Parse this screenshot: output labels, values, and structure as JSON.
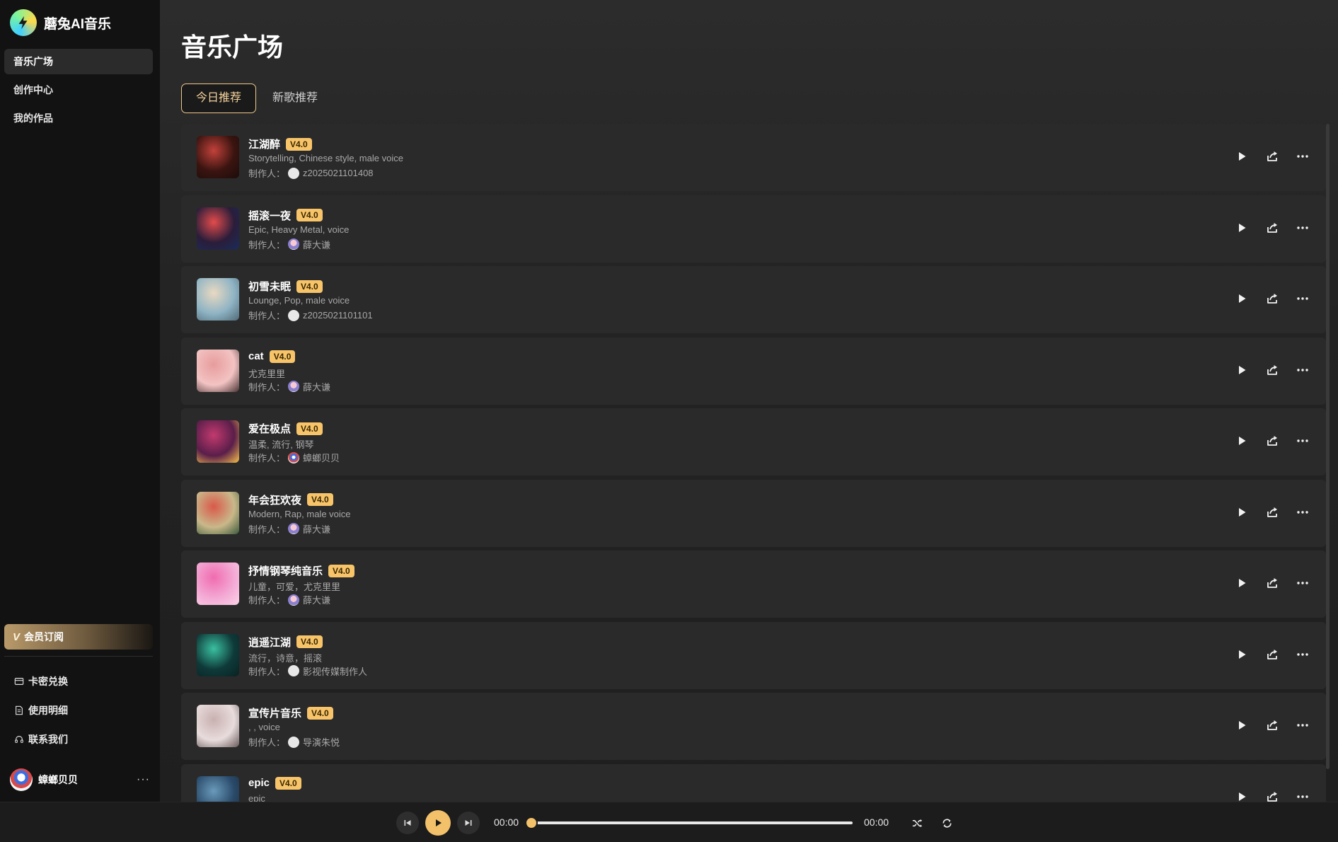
{
  "brand": {
    "name": "蘑兔AI音乐",
    "logo_icon": "lightning-bolt-icon"
  },
  "nav": [
    {
      "label": "音乐广场",
      "active": true
    },
    {
      "label": "创作中心",
      "active": false
    },
    {
      "label": "我的作品",
      "active": false
    }
  ],
  "vip": {
    "label": "会员订阅",
    "icon": "v-badge-icon"
  },
  "side_links": [
    {
      "label": "卡密兑换",
      "icon": "card-icon"
    },
    {
      "label": "使用明细",
      "icon": "document-icon"
    },
    {
      "label": "联系我们",
      "icon": "headset-icon"
    }
  ],
  "user": {
    "name": "蟑螂贝贝",
    "more": "···"
  },
  "page": {
    "title": "音乐广场"
  },
  "tabs": [
    {
      "label": "今日推荐",
      "active": true
    },
    {
      "label": "新歌推荐",
      "active": false
    }
  ],
  "maker_prefix": "制作人：",
  "songs": [
    {
      "name": "江湖醉",
      "version": "V4.0",
      "tags": "Storytelling, Chinese style, male voice",
      "maker": "z2025021101408",
      "cover_colors": [
        "#3a1410",
        "#c2413a",
        "#1b0d0b"
      ],
      "maker_avatar": "plain"
    },
    {
      "name": "摇滚一夜",
      "version": "V4.0",
      "tags": "Epic, Heavy Metal, voice",
      "maker": "薛大谦",
      "cover_colors": [
        "#2a1d3a",
        "#e34b4b",
        "#1a2d5a"
      ],
      "maker_avatar": "pink"
    },
    {
      "name": "初雪未眠",
      "version": "V4.0",
      "tags": "Lounge, Pop, male voice",
      "maker": "z2025021101101",
      "cover_colors": [
        "#8fb4c4",
        "#e9d9c2",
        "#4f6a78"
      ],
      "maker_avatar": "plain"
    },
    {
      "name": "cat",
      "version": "V4.0",
      "tags": "尤克里里",
      "maker": "薛大谦",
      "cover_colors": [
        "#f3c3c3",
        "#e79c9c",
        "#4a3434"
      ],
      "maker_avatar": "pink"
    },
    {
      "name": "爱在极点",
      "version": "V4.0",
      "tags": "温柔, 流行, 钢琴",
      "maker": "蟑螂贝贝",
      "cover_colors": [
        "#5a1e4a",
        "#c23a6e",
        "#f6c04a"
      ],
      "maker_avatar": "bug"
    },
    {
      "name": "年会狂欢夜",
      "version": "V4.0",
      "tags": "Modern, Rap, male voice",
      "maker": "薛大谦",
      "cover_colors": [
        "#c9b88a",
        "#d9594a",
        "#3a5a3a"
      ],
      "maker_avatar": "pink"
    },
    {
      "name": "抒情钢琴纯音乐",
      "version": "V4.0",
      "tags": "儿童，可爱，尤克里里",
      "maker": "薛大谦",
      "cover_colors": [
        "#f3a9d4",
        "#f06cb0",
        "#fbd2e8"
      ],
      "maker_avatar": "pink"
    },
    {
      "name": "逍遥江湖",
      "version": "V4.0",
      "tags": "流行，诗意，摇滚",
      "maker": "影视传媒制作人",
      "cover_colors": [
        "#0f3a3a",
        "#3ac0a0",
        "#0a2222"
      ],
      "maker_avatar": "plain"
    },
    {
      "name": "宣传片音乐",
      "version": "V4.0",
      "tags": ", , voice",
      "maker": "导演朱悦",
      "cover_colors": [
        "#e8dcdc",
        "#c9b0b0",
        "#6a5a5a"
      ],
      "maker_avatar": "plain"
    },
    {
      "name": "epic",
      "version": "V4.0",
      "tags": "epic",
      "maker": "",
      "cover_colors": [
        "#2a4a6a",
        "#6a9aba",
        "#1a2a3a"
      ],
      "maker_avatar": "plain"
    }
  ],
  "row_action_icons": [
    "play-icon",
    "share-icon",
    "more-icon"
  ],
  "player": {
    "current_time": "00:00",
    "total_time": "00:00",
    "progress": 0,
    "icons": [
      "previous-icon",
      "play-icon",
      "next-icon",
      "shuffle-icon",
      "repeat-icon"
    ]
  },
  "colors": {
    "accent": "#f3c16a",
    "version_badge": "#f7c46a",
    "row_bg": "#2a2a2a",
    "sidebar_bg": "#121212"
  }
}
